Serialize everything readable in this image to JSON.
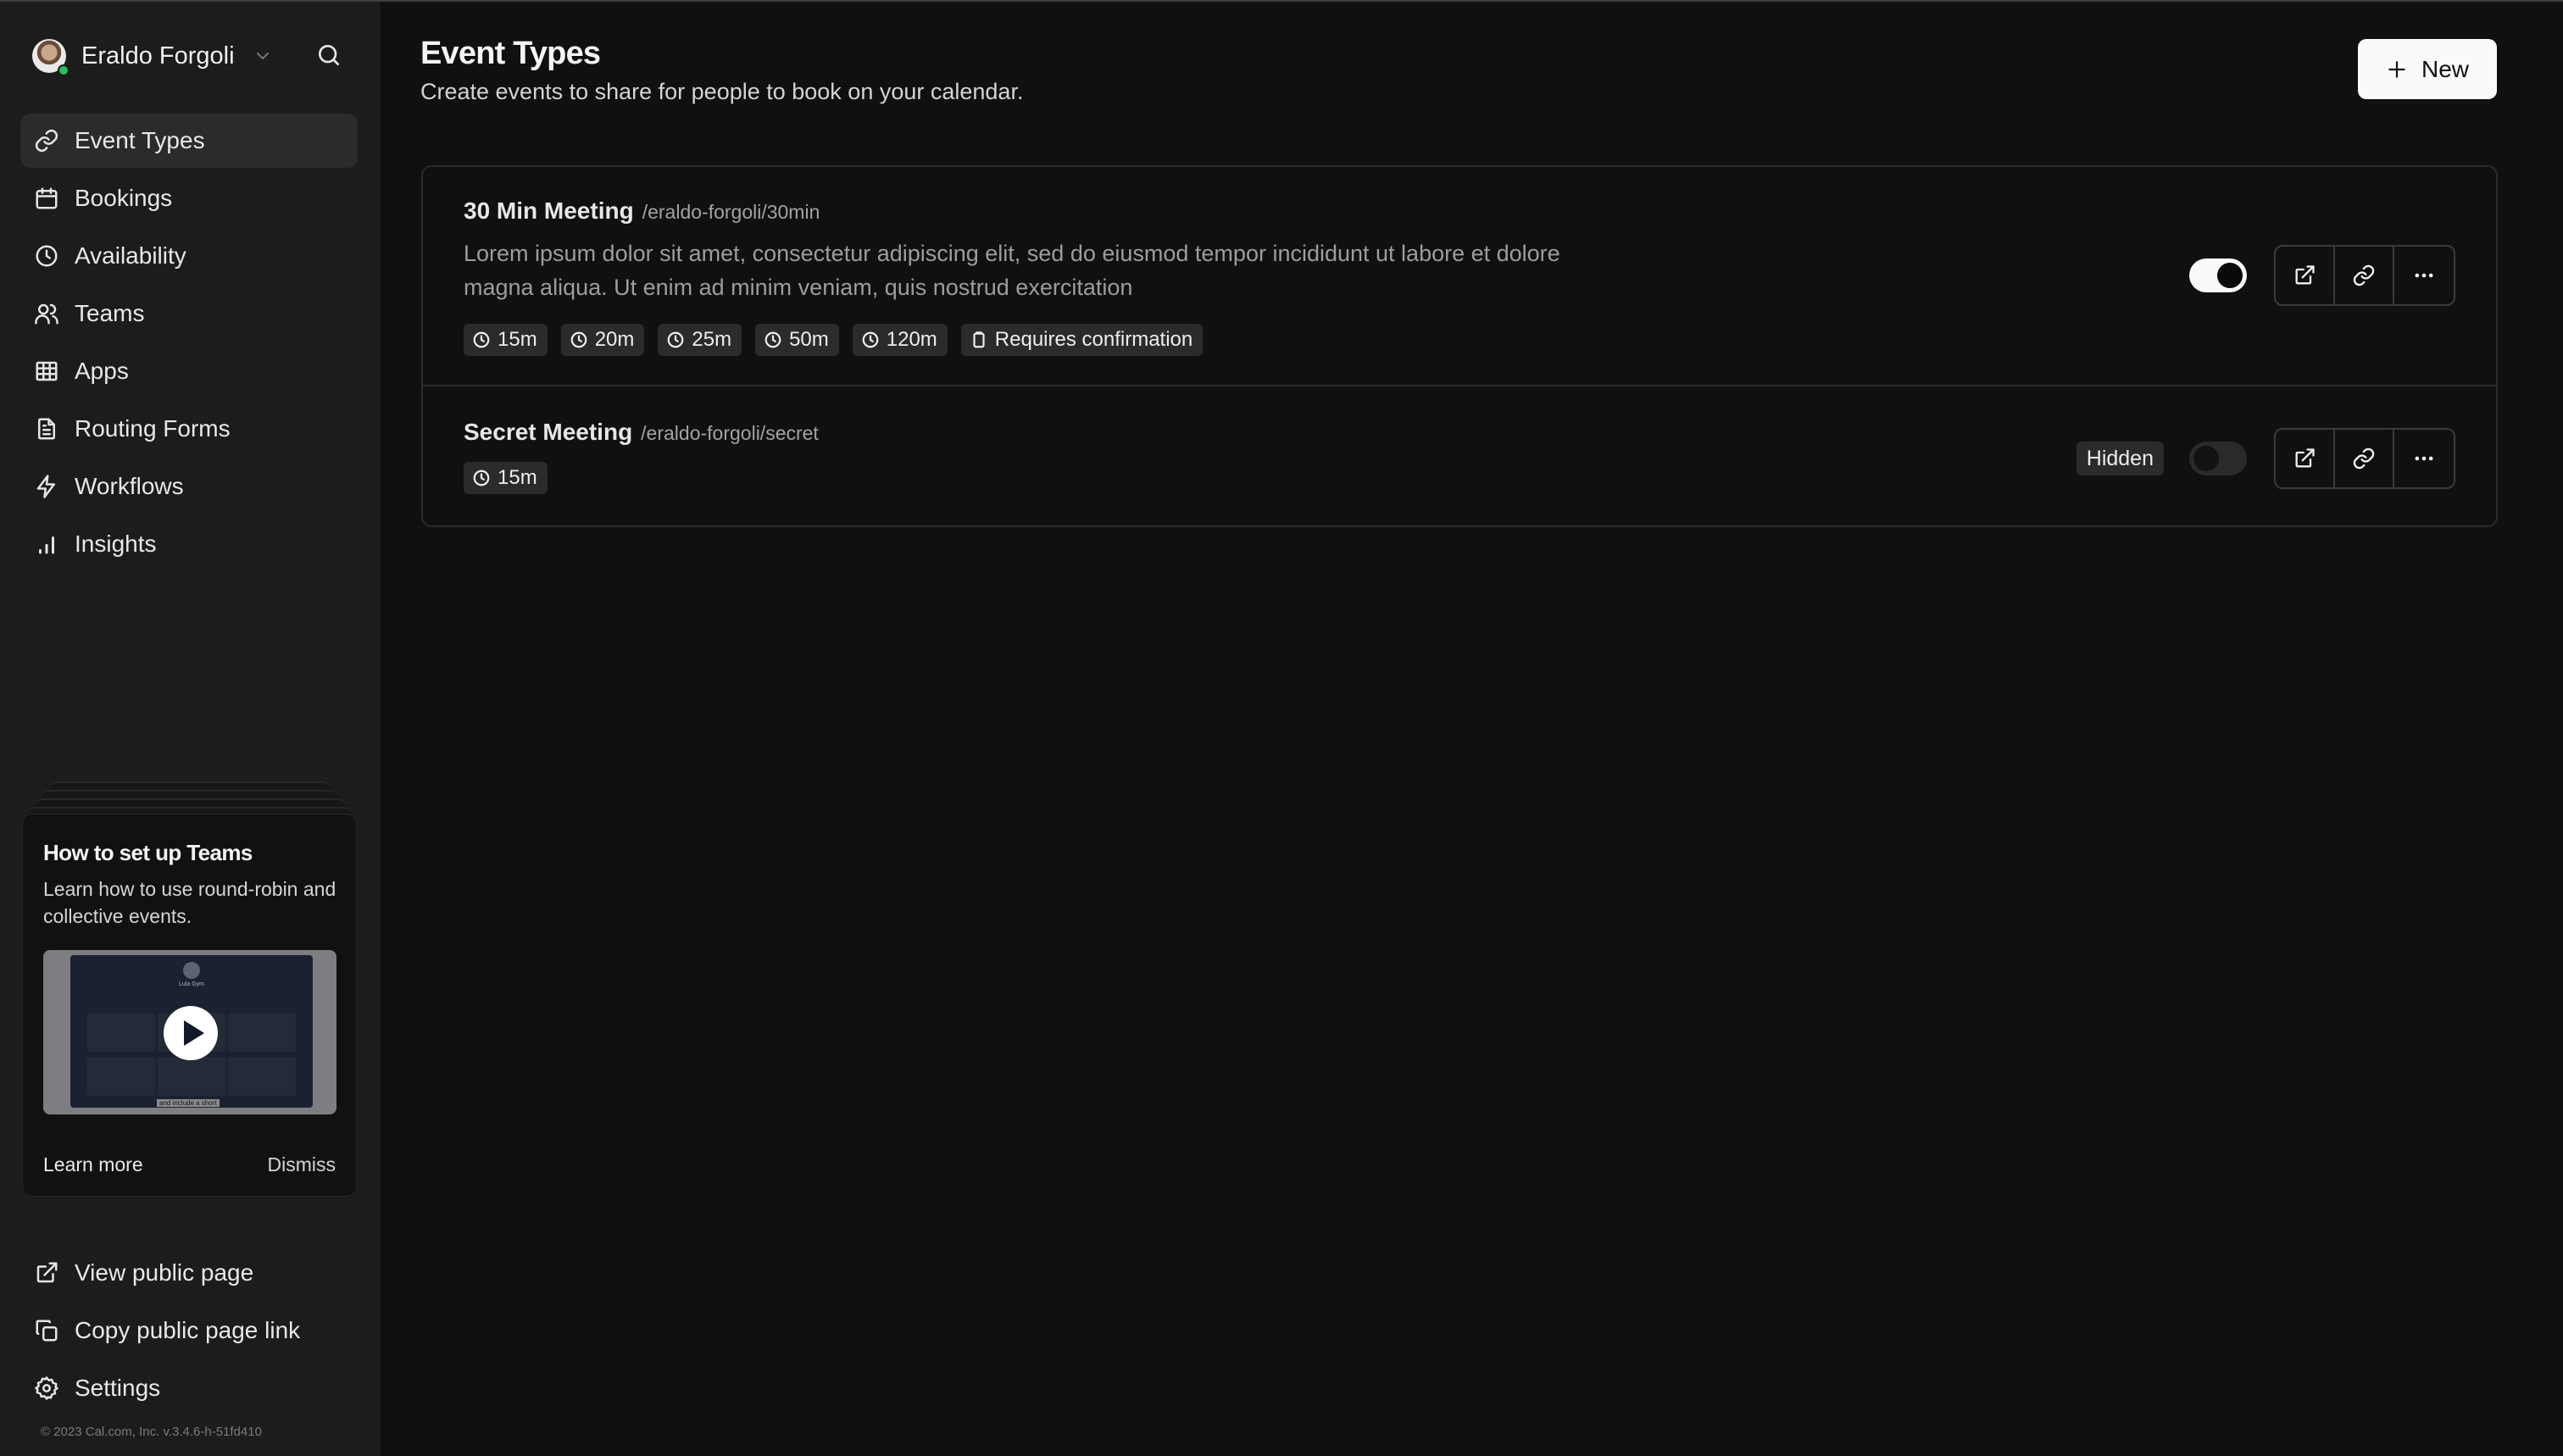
{
  "user": {
    "name": "Eraldo Forgoli",
    "status": "online",
    "status_color": "#22c55e"
  },
  "sidebar": {
    "items": [
      {
        "label": "Event Types",
        "icon": "link-icon",
        "active": true
      },
      {
        "label": "Bookings",
        "icon": "calendar-icon"
      },
      {
        "label": "Availability",
        "icon": "clock-icon"
      },
      {
        "label": "Teams",
        "icon": "users-icon"
      },
      {
        "label": "Apps",
        "icon": "grid-icon"
      },
      {
        "label": "Routing Forms",
        "icon": "file-text-icon"
      },
      {
        "label": "Workflows",
        "icon": "zap-icon"
      },
      {
        "label": "Insights",
        "icon": "bar-chart-icon"
      }
    ],
    "bottom_items": [
      {
        "label": "View public page",
        "icon": "external-link-icon"
      },
      {
        "label": "Copy public page link",
        "icon": "copy-icon"
      },
      {
        "label": "Settings",
        "icon": "settings-icon"
      }
    ],
    "copyright": "© 2023 Cal.com, Inc. v.3.4.6-h-51fd410"
  },
  "promo": {
    "title": "How to set up Teams",
    "description": "Learn how to use round-robin and collective events.",
    "video": {
      "inner_title": "Lula Gym",
      "caption": "and include a short"
    },
    "learn_more": "Learn more",
    "dismiss": "Dismiss"
  },
  "header": {
    "title": "Event Types",
    "subtitle": "Create events to share for people to book on your calendar.",
    "new_button": "New"
  },
  "events": [
    {
      "title": "30 Min Meeting",
      "slug": "/eraldo-forgoli/30min",
      "description": "Lorem ipsum dolor sit amet, consectetur adipiscing elit, sed do eiusmod tempor incididunt ut labore et dolore magna aliqua. Ut enim ad minim veniam, quis nostrud exercitation",
      "durations": [
        "15m",
        "20m",
        "25m",
        "50m",
        "120m"
      ],
      "extra_tag": "Requires confirmation",
      "enabled": true,
      "hidden": false
    },
    {
      "title": "Secret Meeting",
      "slug": "/eraldo-forgoli/secret",
      "durations": [
        "15m"
      ],
      "enabled": false,
      "hidden": true,
      "hidden_label": "Hidden"
    }
  ]
}
